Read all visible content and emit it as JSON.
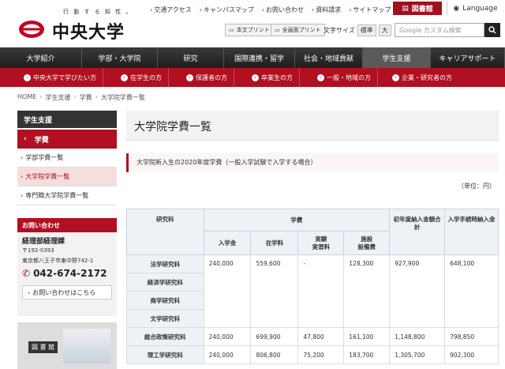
{
  "header": {
    "tagline": "行 動 す る 知 性 。",
    "logo_text": "中央大学",
    "top_links": [
      "交通アクセス",
      "キャンパスマップ",
      "お問い合わせ",
      "資料請求",
      "サイトマップ"
    ],
    "library_button": "図書館",
    "language_button": "Language",
    "print_text_button": "本文プリント",
    "print_all_button": "全画面プリント",
    "font_size_label": "文字サイズ",
    "font_size_standard": "標準",
    "font_size_large": "大",
    "search_placeholder": "Google カスタム検索"
  },
  "main_nav": [
    "大学紹介",
    "学部・大学院",
    "研究",
    "国際連携・留学",
    "社会・地域貢献",
    "学生支援",
    "キャリアサポート"
  ],
  "sub_nav": [
    "中央大学で学びたい方",
    "在学生の方",
    "保護者の方",
    "卒業生の方",
    "一般・地域の方",
    "企業・研究者の方"
  ],
  "breadcrumb": [
    "HOME",
    "学生支援",
    "学費",
    "大学院学費一覧"
  ],
  "sidebar": {
    "heading": "学生支援",
    "section": "学費",
    "items": [
      "学部学費一覧",
      "大学院学費一覧",
      "専門職大学院学費一覧"
    ]
  },
  "contact": {
    "heading": "お問い合わせ",
    "org": "経理部経理課",
    "postal": "〒192-0393",
    "address": "東京都八王子市東中野742-1",
    "tel": "042-674-2172",
    "inquiry_link": "お問い合わせはこちら"
  },
  "banner": {
    "label": "図 書 館"
  },
  "content": {
    "page_title": "大学院学費一覧",
    "notice_title": "大学院新入生の2020年度学費（一般入学試験で入学する場合）",
    "unit": "（単位：円）",
    "table": {
      "h_dept": "研究科",
      "h_fee": "学費",
      "h_first_total": "初年度納入金額合計",
      "h_admission_pay": "入学手続時納入金",
      "h_entrance": "入学金",
      "h_tuition": "在学料",
      "h_lab1": "実験",
      "h_lab2": "実習料",
      "h_fac1": "施設",
      "h_fac2": "設備費",
      "rows": [
        {
          "dept": "法学研究科",
          "entrance": "240,000",
          "tuition": "559,600",
          "lab": "-",
          "facility": "128,300",
          "total": "927,900",
          "admission": "648,100"
        },
        {
          "dept": "経済学研究科",
          "entrance": "",
          "tuition": "",
          "lab": "",
          "facility": "",
          "total": "",
          "admission": ""
        },
        {
          "dept": "商学研究科",
          "entrance": "",
          "tuition": "",
          "lab": "",
          "facility": "",
          "total": "",
          "admission": ""
        },
        {
          "dept": "文学研究科",
          "entrance": "",
          "tuition": "",
          "lab": "",
          "facility": "",
          "total": "",
          "admission": ""
        },
        {
          "dept": "総合政策研究科",
          "entrance": "240,000",
          "tuition": "699,900",
          "lab": "47,800",
          "facility": "161,100",
          "total": "1,148,800",
          "admission": "798,850"
        },
        {
          "dept": "理工学研究科",
          "entrance": "240,000",
          "tuition": "806,800",
          "lab": "75,200",
          "facility": "183,700",
          "total": "1,305,700",
          "admission": "902,300"
        }
      ]
    }
  }
}
